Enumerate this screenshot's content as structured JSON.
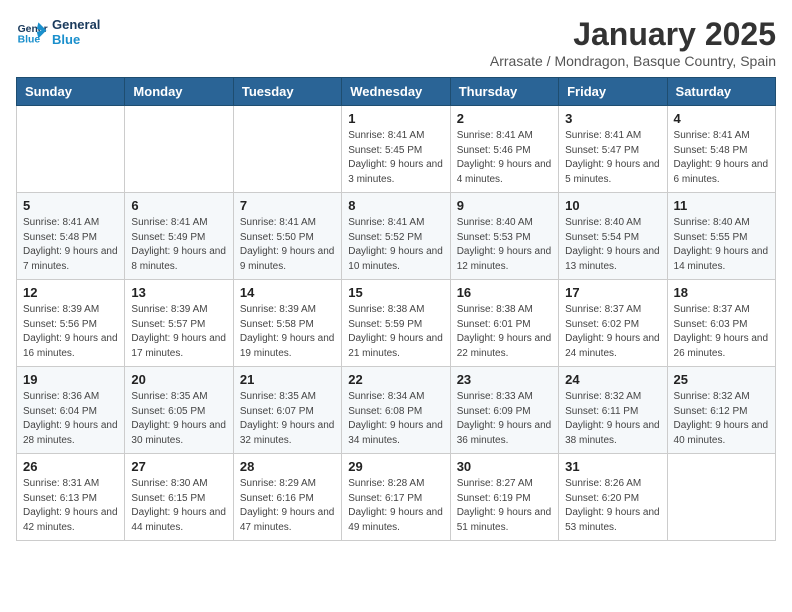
{
  "header": {
    "logo_line1": "General",
    "logo_line2": "Blue",
    "month_year": "January 2025",
    "location": "Arrasate / Mondragon, Basque Country, Spain"
  },
  "weekdays": [
    "Sunday",
    "Monday",
    "Tuesday",
    "Wednesday",
    "Thursday",
    "Friday",
    "Saturday"
  ],
  "weeks": [
    [
      {
        "day": "",
        "detail": ""
      },
      {
        "day": "",
        "detail": ""
      },
      {
        "day": "",
        "detail": ""
      },
      {
        "day": "1",
        "detail": "Sunrise: 8:41 AM\nSunset: 5:45 PM\nDaylight: 9 hours and 3 minutes."
      },
      {
        "day": "2",
        "detail": "Sunrise: 8:41 AM\nSunset: 5:46 PM\nDaylight: 9 hours and 4 minutes."
      },
      {
        "day": "3",
        "detail": "Sunrise: 8:41 AM\nSunset: 5:47 PM\nDaylight: 9 hours and 5 minutes."
      },
      {
        "day": "4",
        "detail": "Sunrise: 8:41 AM\nSunset: 5:48 PM\nDaylight: 9 hours and 6 minutes."
      }
    ],
    [
      {
        "day": "5",
        "detail": "Sunrise: 8:41 AM\nSunset: 5:48 PM\nDaylight: 9 hours and 7 minutes."
      },
      {
        "day": "6",
        "detail": "Sunrise: 8:41 AM\nSunset: 5:49 PM\nDaylight: 9 hours and 8 minutes."
      },
      {
        "day": "7",
        "detail": "Sunrise: 8:41 AM\nSunset: 5:50 PM\nDaylight: 9 hours and 9 minutes."
      },
      {
        "day": "8",
        "detail": "Sunrise: 8:41 AM\nSunset: 5:52 PM\nDaylight: 9 hours and 10 minutes."
      },
      {
        "day": "9",
        "detail": "Sunrise: 8:40 AM\nSunset: 5:53 PM\nDaylight: 9 hours and 12 minutes."
      },
      {
        "day": "10",
        "detail": "Sunrise: 8:40 AM\nSunset: 5:54 PM\nDaylight: 9 hours and 13 minutes."
      },
      {
        "day": "11",
        "detail": "Sunrise: 8:40 AM\nSunset: 5:55 PM\nDaylight: 9 hours and 14 minutes."
      }
    ],
    [
      {
        "day": "12",
        "detail": "Sunrise: 8:39 AM\nSunset: 5:56 PM\nDaylight: 9 hours and 16 minutes."
      },
      {
        "day": "13",
        "detail": "Sunrise: 8:39 AM\nSunset: 5:57 PM\nDaylight: 9 hours and 17 minutes."
      },
      {
        "day": "14",
        "detail": "Sunrise: 8:39 AM\nSunset: 5:58 PM\nDaylight: 9 hours and 19 minutes."
      },
      {
        "day": "15",
        "detail": "Sunrise: 8:38 AM\nSunset: 5:59 PM\nDaylight: 9 hours and 21 minutes."
      },
      {
        "day": "16",
        "detail": "Sunrise: 8:38 AM\nSunset: 6:01 PM\nDaylight: 9 hours and 22 minutes."
      },
      {
        "day": "17",
        "detail": "Sunrise: 8:37 AM\nSunset: 6:02 PM\nDaylight: 9 hours and 24 minutes."
      },
      {
        "day": "18",
        "detail": "Sunrise: 8:37 AM\nSunset: 6:03 PM\nDaylight: 9 hours and 26 minutes."
      }
    ],
    [
      {
        "day": "19",
        "detail": "Sunrise: 8:36 AM\nSunset: 6:04 PM\nDaylight: 9 hours and 28 minutes."
      },
      {
        "day": "20",
        "detail": "Sunrise: 8:35 AM\nSunset: 6:05 PM\nDaylight: 9 hours and 30 minutes."
      },
      {
        "day": "21",
        "detail": "Sunrise: 8:35 AM\nSunset: 6:07 PM\nDaylight: 9 hours and 32 minutes."
      },
      {
        "day": "22",
        "detail": "Sunrise: 8:34 AM\nSunset: 6:08 PM\nDaylight: 9 hours and 34 minutes."
      },
      {
        "day": "23",
        "detail": "Sunrise: 8:33 AM\nSunset: 6:09 PM\nDaylight: 9 hours and 36 minutes."
      },
      {
        "day": "24",
        "detail": "Sunrise: 8:32 AM\nSunset: 6:11 PM\nDaylight: 9 hours and 38 minutes."
      },
      {
        "day": "25",
        "detail": "Sunrise: 8:32 AM\nSunset: 6:12 PM\nDaylight: 9 hours and 40 minutes."
      }
    ],
    [
      {
        "day": "26",
        "detail": "Sunrise: 8:31 AM\nSunset: 6:13 PM\nDaylight: 9 hours and 42 minutes."
      },
      {
        "day": "27",
        "detail": "Sunrise: 8:30 AM\nSunset: 6:15 PM\nDaylight: 9 hours and 44 minutes."
      },
      {
        "day": "28",
        "detail": "Sunrise: 8:29 AM\nSunset: 6:16 PM\nDaylight: 9 hours and 47 minutes."
      },
      {
        "day": "29",
        "detail": "Sunrise: 8:28 AM\nSunset: 6:17 PM\nDaylight: 9 hours and 49 minutes."
      },
      {
        "day": "30",
        "detail": "Sunrise: 8:27 AM\nSunset: 6:19 PM\nDaylight: 9 hours and 51 minutes."
      },
      {
        "day": "31",
        "detail": "Sunrise: 8:26 AM\nSunset: 6:20 PM\nDaylight: 9 hours and 53 minutes."
      },
      {
        "day": "",
        "detail": ""
      }
    ]
  ]
}
